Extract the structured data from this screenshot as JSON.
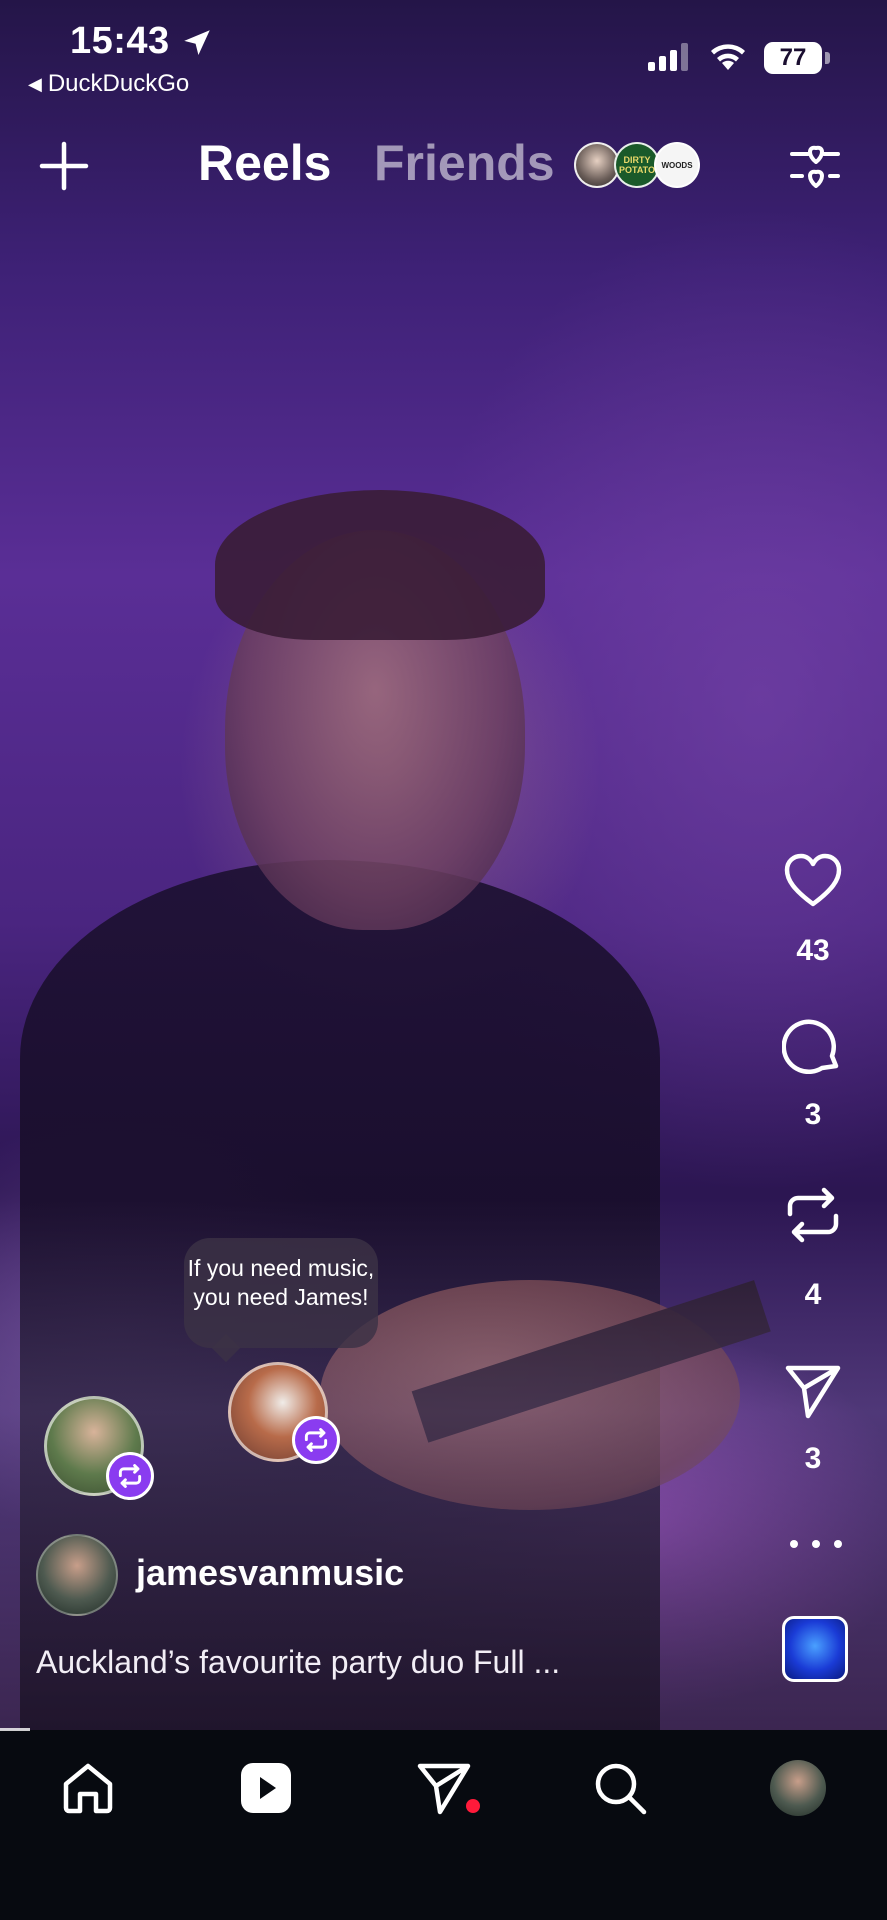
{
  "status_bar": {
    "time": "15:43",
    "back_app": "DuckDuckGo",
    "battery": "77"
  },
  "header": {
    "tabs": [
      {
        "label": "Reels",
        "active": true
      },
      {
        "label": "Friends",
        "active": false
      }
    ],
    "friend_avatar_texts": [
      "",
      "DIRTY POTATO",
      "WOODS"
    ]
  },
  "reel": {
    "likes": "43",
    "comments": "3",
    "reposts": "4",
    "shares": "3",
    "tooltip": "If you need music, you need James!",
    "author": "jamesvanmusic",
    "caption": "Auckland’s favourite party duo Full ..."
  },
  "colors": {
    "accent_purple": "#8a3cf0",
    "notification_dot": "#ff1a3a",
    "nav_background": "#070a10"
  },
  "icons": {
    "rail": [
      "heart-icon",
      "comment-icon",
      "repost-icon",
      "send-icon",
      "more-icon"
    ],
    "nav": [
      "home-icon",
      "reels-icon",
      "messages-icon",
      "search-icon",
      "profile-avatar"
    ]
  }
}
